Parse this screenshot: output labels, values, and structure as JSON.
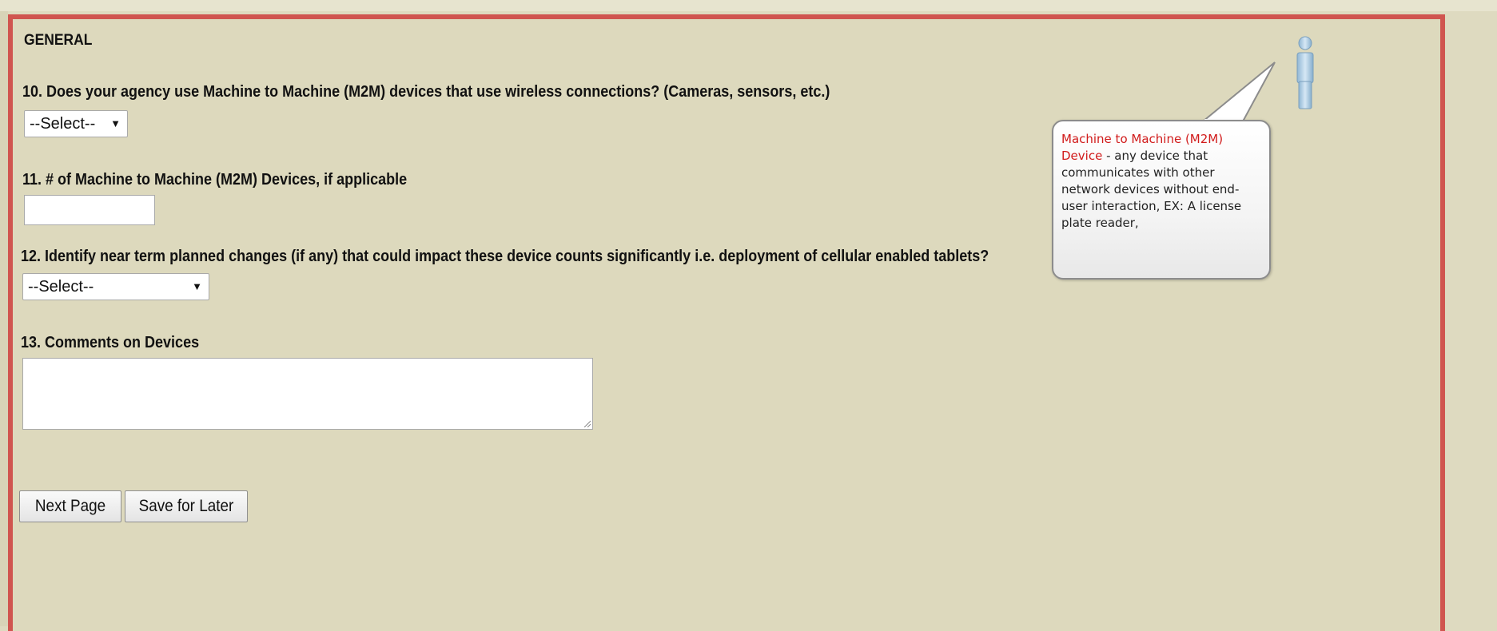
{
  "section": {
    "title": "GENERAL"
  },
  "questions": {
    "q10": {
      "label": "10. Does your agency use Machine to Machine (M2M) devices that use wireless connections? (Cameras, sensors, etc.)",
      "selected": "--Select--"
    },
    "q11": {
      "label": "11. # of Machine to Machine (M2M) Devices, if applicable",
      "value": ""
    },
    "q12": {
      "label": "12. Identify near term planned changes (if any) that could impact these device counts significantly i.e. deployment of cellular enabled tablets?",
      "selected": "--Select--"
    },
    "q13": {
      "label": "13. Comments on Devices",
      "value": ""
    }
  },
  "buttons": {
    "next_page": "Next Page",
    "save_for_later": "Save for Later"
  },
  "tooltip": {
    "term": "Machine to Machine (M2M) Device",
    "definition": " - any device that communicates with other network devices without end-user interaction, EX: A license plate reader,"
  },
  "icons": {
    "help_person": "person-help-icon",
    "dropdown_caret": "caret-down-icon",
    "resize_grip": "resize-grip-icon"
  },
  "colors": {
    "page_background": "#dedac0",
    "panel_border": "#d0554f",
    "tooltip_term": "#d11b1b"
  }
}
